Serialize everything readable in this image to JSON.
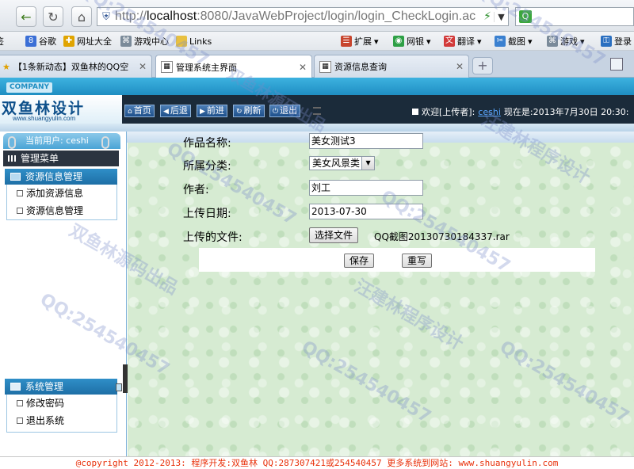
{
  "browser": {
    "url_prefix": "http://",
    "url_host": "localhost",
    "url_rest": ":8080/JavaWebProject/login/login_CheckLogin.ac",
    "bookmarks": [
      {
        "label": "签"
      },
      {
        "label": "谷歌"
      },
      {
        "label": "网址大全"
      },
      {
        "label": "游戏中心"
      },
      {
        "label": "Links"
      },
      {
        "label": "扩展"
      },
      {
        "label": "网银"
      },
      {
        "label": "翻译"
      },
      {
        "label": "截图"
      },
      {
        "label": "游戏"
      },
      {
        "label": "登录"
      }
    ],
    "tabs": [
      {
        "label": "【1条新动态】双鱼林的QQ空",
        "active": false
      },
      {
        "label": "管理系统主界面",
        "active": true
      },
      {
        "label": "资源信息查询",
        "active": false
      }
    ]
  },
  "header": {
    "company_tag": "COMPANY",
    "logo_text": "双鱼林设计",
    "logo_url": "www.shuangyulin.com",
    "buttons": [
      {
        "icon": "home-icon",
        "label": "首页"
      },
      {
        "icon": "back-icon",
        "label": "后退"
      },
      {
        "icon": "forward-icon",
        "label": "前进"
      },
      {
        "icon": "refresh-icon",
        "label": "刷新"
      },
      {
        "icon": "power-icon",
        "label": "退出"
      }
    ],
    "welcome_prefix": "欢迎[上传者]:",
    "welcome_user": "ceshi",
    "welcome_suffix": "现在是:2013年7月30日 20:30:"
  },
  "sidebar": {
    "current_user": "当前用户: ceshi",
    "menu_title": "管理菜单",
    "sections": [
      {
        "title": "资源信息管理",
        "items": [
          "添加资源信息",
          "资源信息管理"
        ]
      },
      {
        "title": "系统管理",
        "items": [
          "修改密码",
          "退出系统"
        ]
      }
    ]
  },
  "form": {
    "fields": [
      {
        "label": "作品名称:",
        "value": "美女测试3"
      },
      {
        "label": "所属分类:",
        "value": "美女风景类"
      },
      {
        "label": "作者:",
        "value": "刘工"
      },
      {
        "label": "上传日期:",
        "value": "2013-07-30"
      },
      {
        "label": "上传的文件:",
        "value": "QQ截图20130730184337.rar"
      }
    ],
    "choose_file_label": "选择文件",
    "save_label": "保存",
    "reset_label": "重写"
  },
  "watermark": {
    "qq": "QQ:254540457",
    "source": "双鱼林源码出品",
    "design": "汪建林程序设计"
  },
  "footer": {
    "text": "@copyright 2012-2013: 程序开发:双鱼林  QQ:287307421或254540457  更多系统到网站: www.shuangyulin.com"
  }
}
